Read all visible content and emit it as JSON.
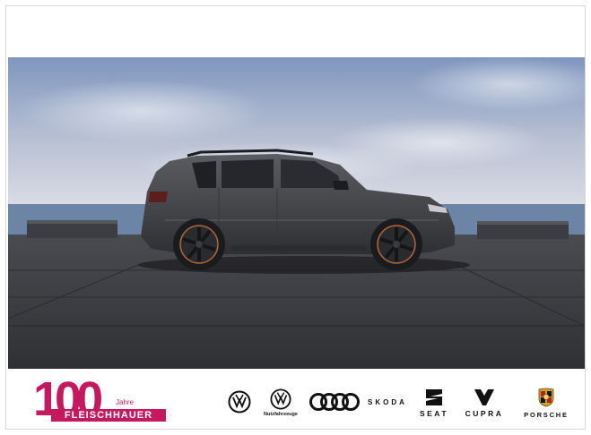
{
  "dealer_logo": {
    "number": "100",
    "years_label": "Jahre",
    "name": "FLEISCHHAUER",
    "color": "#c4185f"
  },
  "brands": [
    {
      "name": "Volkswagen",
      "icon": "vw-icon",
      "label": ""
    },
    {
      "name": "Volkswagen Nutzfahrzeuge",
      "icon": "vw-icon",
      "label": "Nutzfahrzeuge"
    },
    {
      "name": "Audi",
      "icon": "audi-rings-icon",
      "label": ""
    },
    {
      "name": "Skoda",
      "icon": "skoda-wordmark",
      "label": "SKODA"
    },
    {
      "name": "Seat",
      "icon": "seat-s-icon",
      "label": "SEAT"
    },
    {
      "name": "Cupra",
      "icon": "cupra-icon",
      "label": "CUPRA"
    },
    {
      "name": "Porsche",
      "icon": "porsche-crest-icon",
      "label": "PORSCHE"
    }
  ],
  "colors": {
    "sky_top": "#7f96bf",
    "sky_bottom": "#d9dbe5",
    "sea": "#6c84a6",
    "ground": "#3a3b3f",
    "car_body": "#4a4b4f",
    "accent_copper": "#b5653a"
  }
}
